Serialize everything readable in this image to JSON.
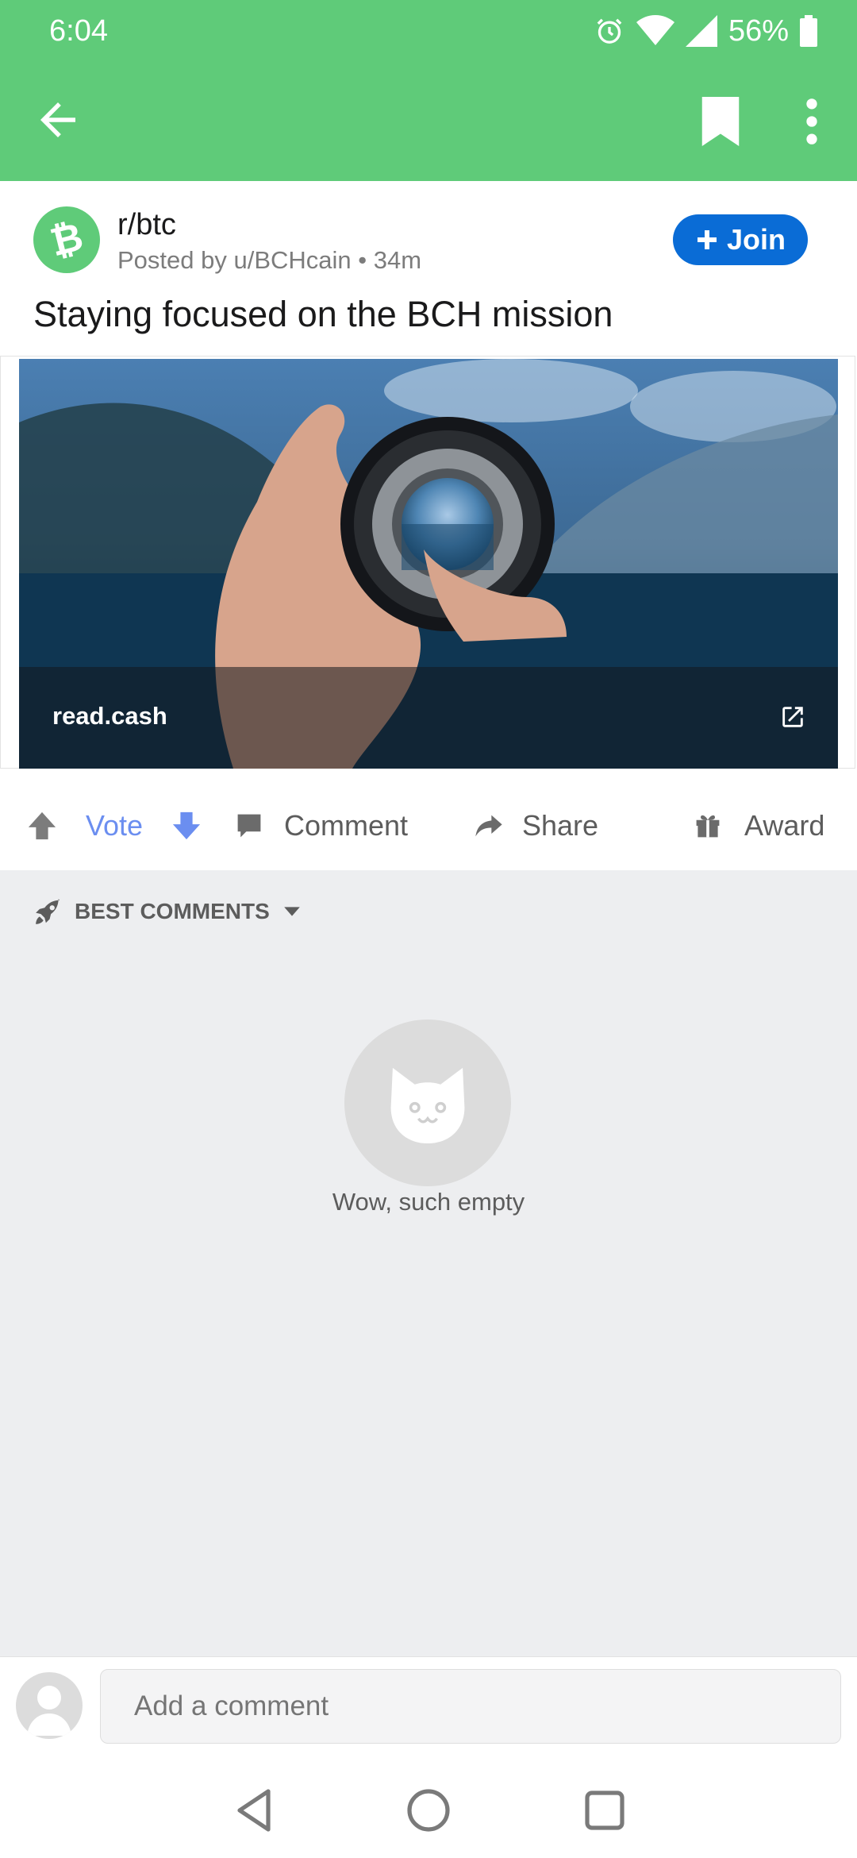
{
  "status": {
    "time": "6:04",
    "battery": "56%"
  },
  "post": {
    "subreddit": "r/btc",
    "meta": "Posted by u/BCHcain • 34m",
    "join_label": "Join",
    "title": "Staying focused on the BCH mission",
    "link_domain": "read.cash"
  },
  "actions": {
    "vote": "Vote",
    "comment": "Comment",
    "share": "Share",
    "award": "Award"
  },
  "comments": {
    "sort_label": "BEST COMMENTS",
    "empty_text": "Wow, such empty"
  },
  "comment_bar": {
    "placeholder": "Add a comment"
  },
  "colors": {
    "toolbar": "#5fcb79",
    "join": "#0a6cd6",
    "vote": "#6b8ef0"
  },
  "icons": [
    "alarm-icon",
    "wifi-icon",
    "signal-icon",
    "battery-icon",
    "back-arrow-icon",
    "bookmark-icon",
    "more-vert-icon",
    "bitcoin-cash-icon",
    "plus-icon",
    "external-link-icon",
    "upvote-icon",
    "downvote-icon",
    "comment-icon",
    "share-icon",
    "award-icon",
    "rocket-icon",
    "caret-down-icon",
    "cat-face-icon",
    "user-avatar-icon",
    "nav-back-icon",
    "nav-home-icon",
    "nav-recents-icon"
  ]
}
